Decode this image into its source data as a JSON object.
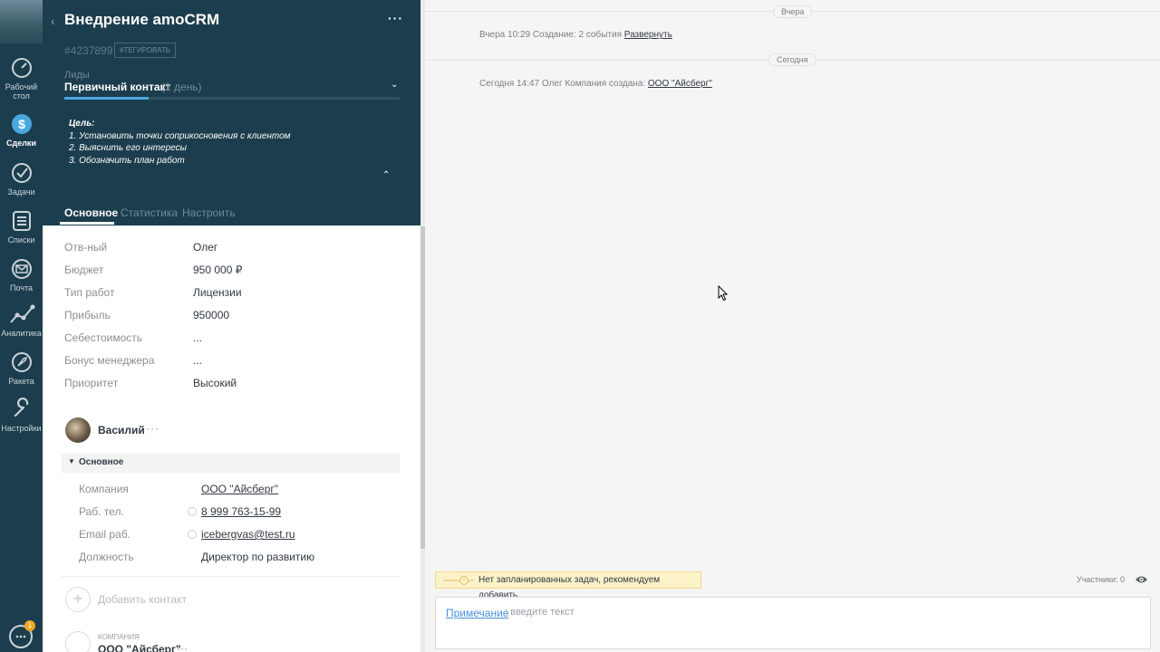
{
  "nav": {
    "items": [
      {
        "label": "Рабочий стол",
        "icon": "dashboard-icon"
      },
      {
        "label": "Сделки",
        "icon": "deals-icon",
        "active": true
      },
      {
        "label": "Задачи",
        "icon": "tasks-icon"
      },
      {
        "label": "Списки",
        "icon": "lists-icon"
      },
      {
        "label": "Почта",
        "icon": "mail-icon"
      },
      {
        "label": "Аналитика",
        "icon": "analytics-icon"
      },
      {
        "label": "Ракета",
        "icon": "rocket-icon"
      },
      {
        "label": "Настройки",
        "icon": "settings-icon"
      }
    ],
    "chat_badge": "1"
  },
  "lead": {
    "title": "Внедрение amoCRM",
    "id": "#4237899",
    "tag_button": "#ТЕГИРОВАТЬ",
    "pipeline": "Лиды",
    "stage": "Первичный контакт",
    "stage_duration": "(1 день)",
    "goal": {
      "title": "Цель:",
      "lines": [
        "1. Установить точки соприкосновения с клиентом",
        "2. Выяснить его интересы",
        "3. Обозначить план работ"
      ]
    },
    "tabs": [
      "Основное",
      "Статистика",
      "Настроить"
    ],
    "fields": [
      {
        "label": "Отв-ный",
        "value": "Олег"
      },
      {
        "label": "Бюджет",
        "value": "950 000  ₽"
      },
      {
        "label": "Тип работ",
        "value": "Лицензии"
      },
      {
        "label": "Прибыль",
        "value": "950000"
      },
      {
        "label": "Себестоимость",
        "value": "..."
      },
      {
        "label": "Бонус менеджера",
        "value": "..."
      },
      {
        "label": "Приоритет",
        "value": "Высокий"
      }
    ]
  },
  "contact": {
    "name": "Василий",
    "more": "···",
    "section_title": "Основное",
    "fields": [
      {
        "label": "Компания",
        "value": "ООО \"Айсберг\"",
        "link": true
      },
      {
        "label": "Раб. тел.",
        "value": "8 999 763-15-99",
        "link": true
      },
      {
        "label": "Email раб.",
        "value": "icebergvas@test.ru",
        "link": true
      },
      {
        "label": "Должность",
        "value": "Директор по развитию",
        "link": false
      }
    ],
    "add_contact": "Добавить контакт"
  },
  "company": {
    "caption": "КОМПАНИЯ",
    "name": "ООО \"Айсберг\"",
    "more": "···"
  },
  "feed": {
    "yesterday_label": "Вчера",
    "yesterday_event_text": "Вчера 10:29 Создание: 2 события",
    "yesterday_event_link": "Развернуть",
    "today_label": "Сегодня",
    "today_event_text": "Сегодня 14:47 Олег Компания создана:",
    "today_event_link": "ООО \"Айсберг\""
  },
  "footer": {
    "task_text": "Нет запланированных задач, рекомендуем",
    "task_link": "добавить",
    "participants": "Участники: 0",
    "note_type": "Примечание",
    "note_placeholder": ": введите текст"
  }
}
